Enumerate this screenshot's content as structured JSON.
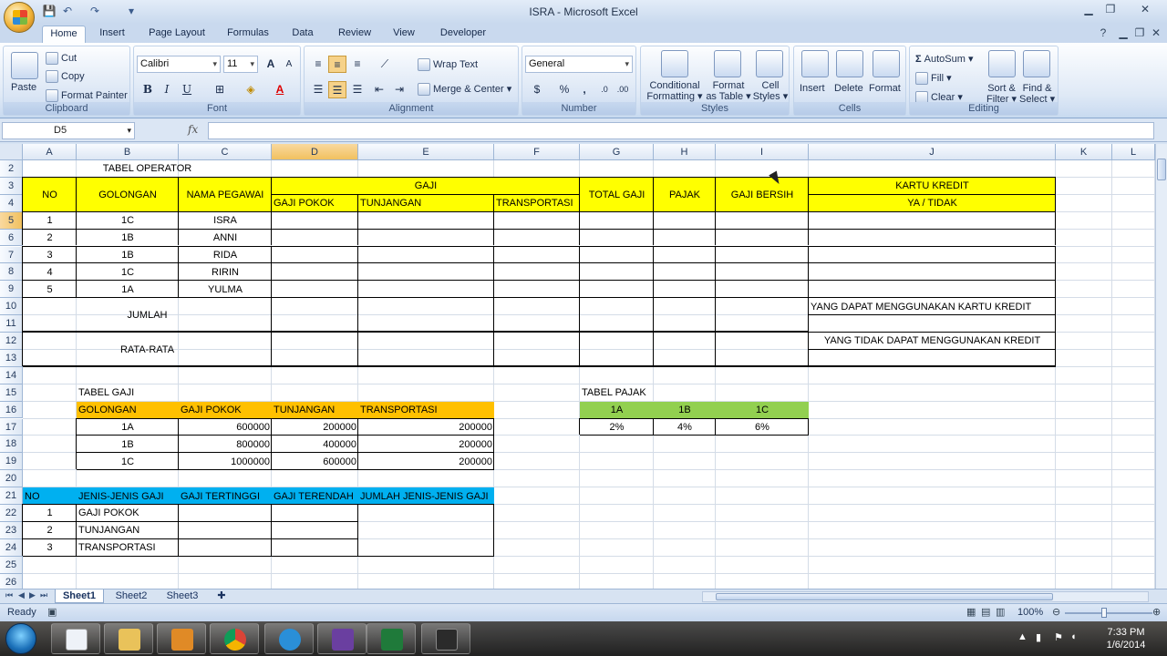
{
  "window": {
    "title": "ISRA - Microsoft Excel"
  },
  "ribbon_tabs": [
    "Home",
    "Insert",
    "Page Layout",
    "Formulas",
    "Data",
    "Review",
    "View",
    "Developer"
  ],
  "ribbon": {
    "clipboard": {
      "paste": "Paste",
      "cut": "Cut",
      "copy": "Copy",
      "format_painter": "Format Painter",
      "label": "Clipboard"
    },
    "font": {
      "name": "Calibri",
      "size": "11",
      "label": "Font",
      "bold": "B",
      "italic": "I",
      "underline": "U"
    },
    "alignment": {
      "wrap_text": "Wrap Text",
      "merge_center": "Merge & Center",
      "label": "Alignment"
    },
    "number": {
      "format": "General",
      "label": "Number",
      "currency": "$",
      "percent": "%",
      "comma": ","
    },
    "styles": {
      "conditional_1": "Conditional",
      "conditional_2": "Formatting",
      "table_1": "Format",
      "table_2": "as Table",
      "cell_1": "Cell",
      "cell_2": "Styles",
      "label": "Styles"
    },
    "cells": {
      "insert": "Insert",
      "delete": "Delete",
      "format": "Format",
      "label": "Cells"
    },
    "editing": {
      "autosum": "AutoSum",
      "fill": "Fill",
      "clear": "Clear",
      "sort_1": "Sort &",
      "sort_2": "Filter",
      "find_1": "Find &",
      "find_2": "Select",
      "label": "Editing"
    }
  },
  "formula_bar": {
    "name_box": "D5",
    "fx": "fx",
    "formula": ""
  },
  "columns": [
    "A",
    "B",
    "C",
    "D",
    "E",
    "F",
    "G",
    "H",
    "I",
    "J",
    "K",
    "L"
  ],
  "rows": [
    "2",
    "3",
    "4",
    "5",
    "6",
    "7",
    "8",
    "9",
    "10",
    "11",
    "12",
    "13",
    "14",
    "15",
    "16",
    "17",
    "18",
    "19",
    "20",
    "21",
    "22",
    "23",
    "24",
    "25",
    "26"
  ],
  "sheet": {
    "tabel_operator": "TABEL OPERATOR",
    "header": {
      "no": "NO",
      "golongan": "GOLONGAN",
      "nama_pegawai": "NAMA PEGAWAI",
      "gaji": "GAJI",
      "gaji_pokok": "GAJI POKOK",
      "tunjangan": "TUNJANGAN",
      "transportasi": "TRANSPORTASI",
      "total_gaji": "TOTAL GAJI",
      "pajak": "PAJAK",
      "gaji_bersih": "GAJI BERSIH",
      "kartu_kredit": "KARTU KREDIT",
      "ya_tidak": "YA / TIDAK"
    },
    "employees": [
      {
        "no": "1",
        "golongan": "1C",
        "nama": "ISRA"
      },
      {
        "no": "2",
        "golongan": "1B",
        "nama": "ANNI"
      },
      {
        "no": "3",
        "golongan": "1B",
        "nama": "RIDA"
      },
      {
        "no": "4",
        "golongan": "1C",
        "nama": "RIRIN"
      },
      {
        "no": "5",
        "golongan": "1A",
        "nama": "YULMA"
      }
    ],
    "jumlah": "JUMLAH",
    "rata_rata": "RATA-RATA",
    "kartu_ya": "YANG DAPAT MENGGUNAKAN KARTU KREDIT",
    "kartu_tidak": "YANG TIDAK DAPAT MENGGUNAKAN KREDIT",
    "tabel_gaji": {
      "title": "TABEL GAJI",
      "headers": [
        "GOLONGAN",
        "GAJI POKOK",
        "TUNJANGAN",
        "TRANSPORTASI"
      ],
      "rows": [
        [
          "1A",
          "600000",
          "200000",
          "200000"
        ],
        [
          "1B",
          "800000",
          "400000",
          "200000"
        ],
        [
          "1C",
          "1000000",
          "600000",
          "200000"
        ]
      ]
    },
    "tabel_pajak": {
      "title": "TABEL PAJAK",
      "headers": [
        "1A",
        "1B",
        "1C"
      ],
      "values": [
        "2%",
        "4%",
        "6%"
      ]
    },
    "jenis_gaji": {
      "headers": [
        "NO",
        "JENIS-JENIS GAJI",
        "GAJI TERTINGGI",
        "GAJI TERENDAH",
        "JUMLAH JENIS-JENIS GAJI"
      ],
      "rows": [
        [
          "1",
          "GAJI POKOK"
        ],
        [
          "2",
          "TUNJANGAN"
        ],
        [
          "3",
          "TRANSPORTASI"
        ]
      ]
    }
  },
  "sheet_tabs": [
    "Sheet1",
    "Sheet2",
    "Sheet3"
  ],
  "status": {
    "ready": "Ready",
    "zoom": "100%"
  },
  "taskbar": {
    "time": "7:33 PM",
    "date": "1/6/2014"
  }
}
